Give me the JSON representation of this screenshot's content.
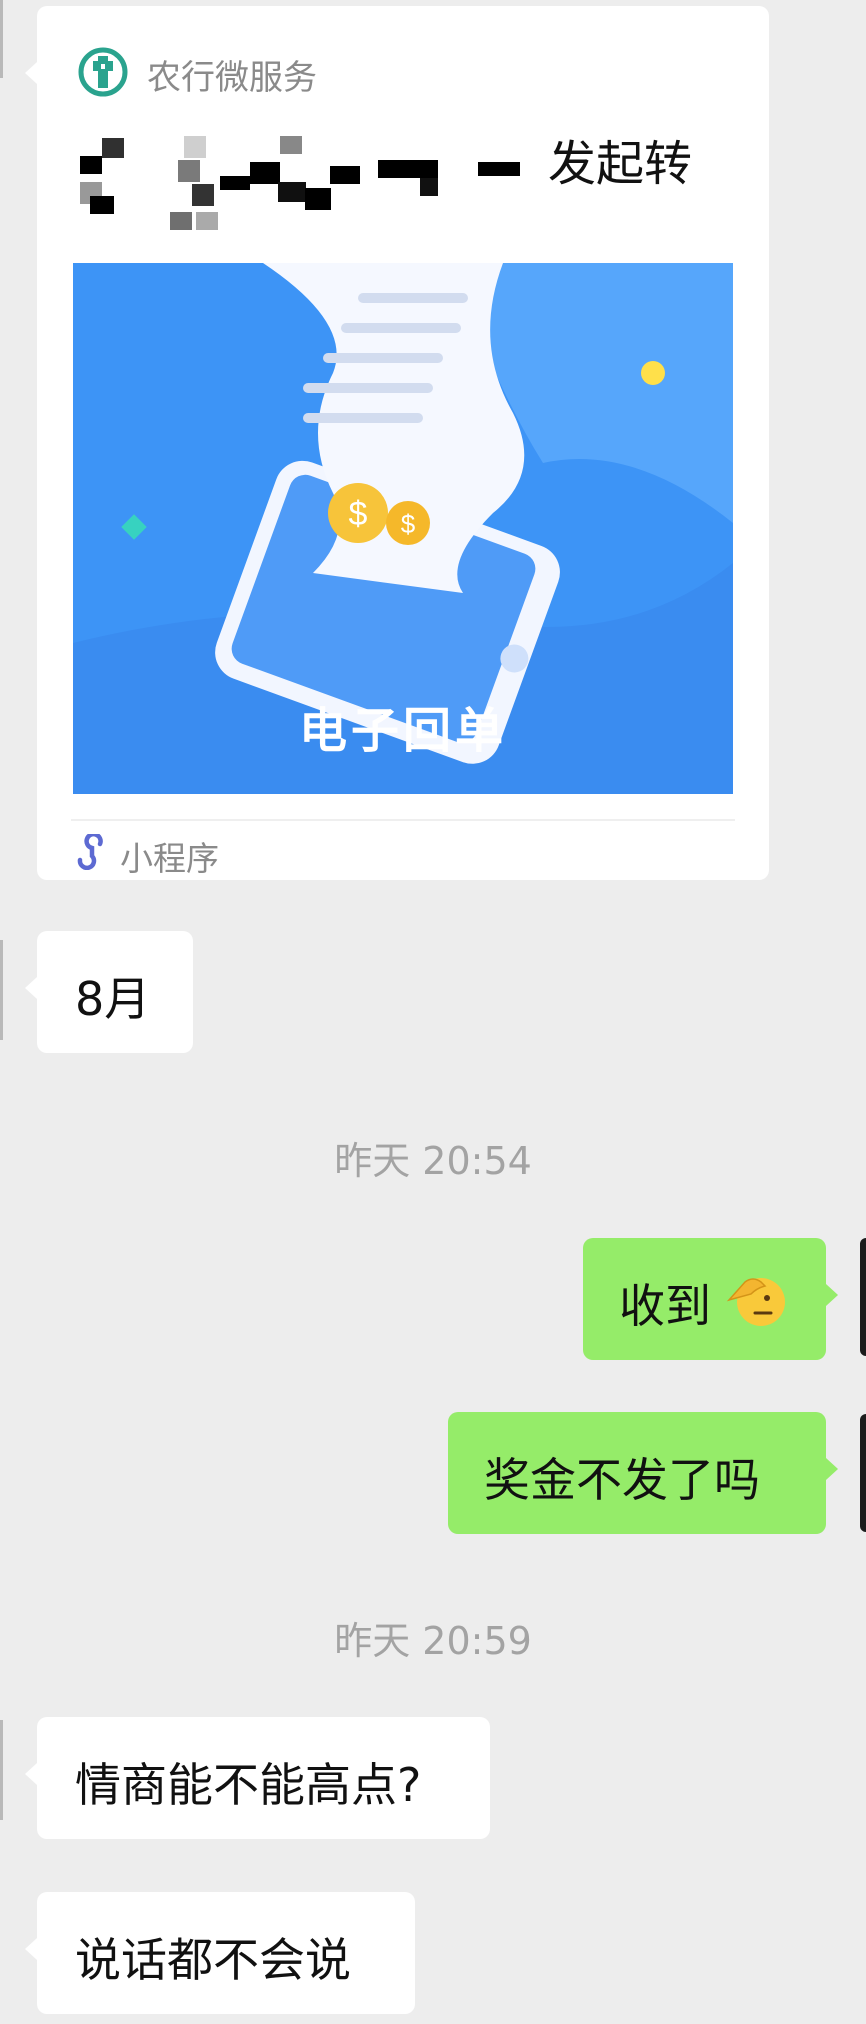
{
  "mini_program_card": {
    "service_name": "农行微服务",
    "title_visible": "发起转",
    "image_caption": "电子回单",
    "footer_label": "小程序",
    "icon": "abc-bank-logo-icon",
    "footer_icon": "mini-program-link-icon"
  },
  "messages": [
    {
      "side": "left",
      "text": "8月"
    },
    {
      "side": "right",
      "text": "收到"
    },
    {
      "side": "right",
      "text": "奖金不发了吗"
    },
    {
      "side": "left",
      "text": "情商能不能高点?"
    },
    {
      "side": "left",
      "text": "说话都不会说"
    }
  ],
  "timestamps": [
    "昨天 20:54",
    "昨天 20:59"
  ],
  "emoji": "saluting-face-icon",
  "colors": {
    "background": "#ededed",
    "incoming_bubble": "#ffffff",
    "outgoing_bubble": "#95ec69",
    "card_banner": "#3d94f6",
    "timestamp_text": "#a3a3a3"
  }
}
